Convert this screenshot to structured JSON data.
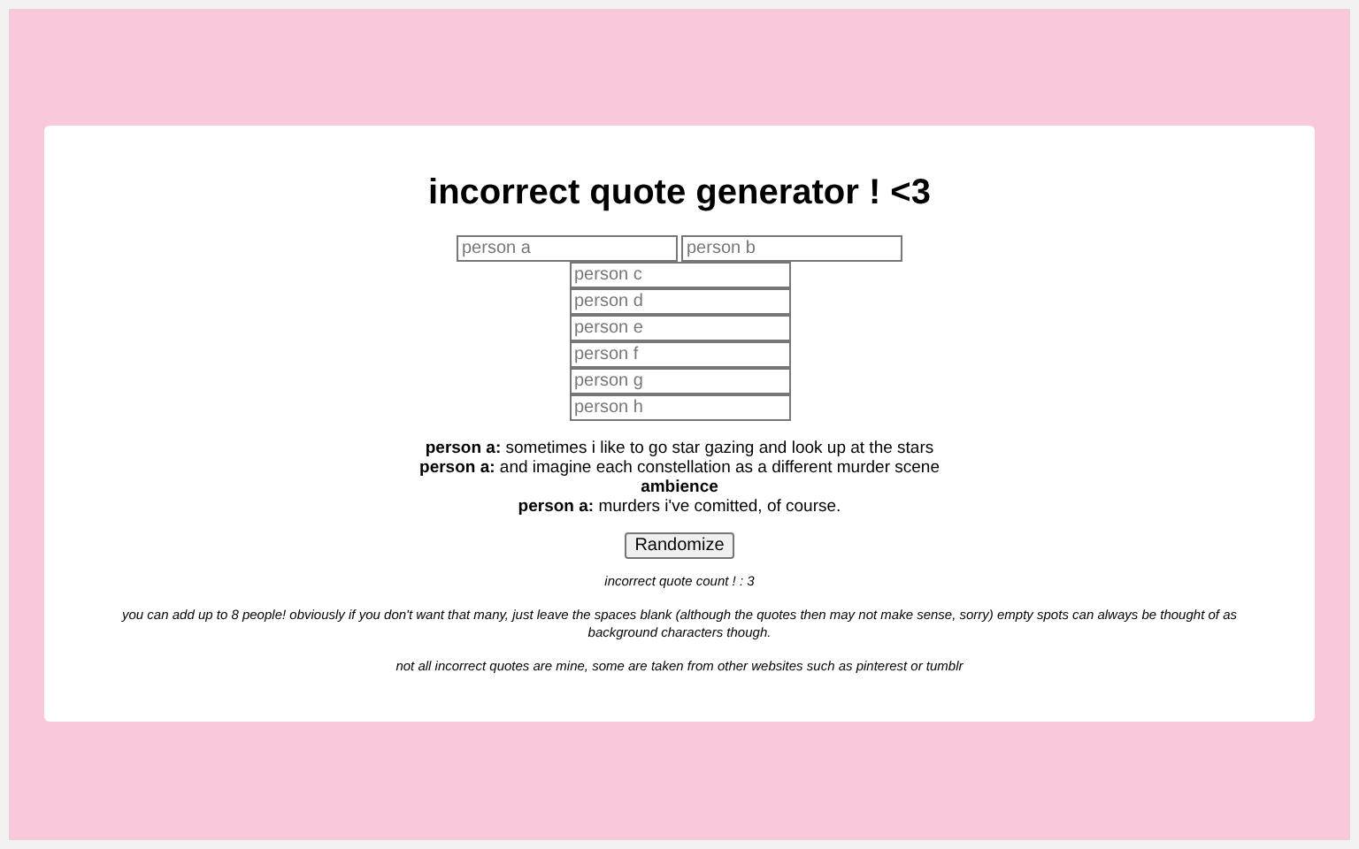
{
  "title": "incorrect quote generator ! <3",
  "inputs": [
    {
      "placeholder": "person a"
    },
    {
      "placeholder": "person b"
    },
    {
      "placeholder": "person c"
    },
    {
      "placeholder": "person d"
    },
    {
      "placeholder": "person e"
    },
    {
      "placeholder": "person f"
    },
    {
      "placeholder": "person g"
    },
    {
      "placeholder": "person h"
    }
  ],
  "quote": [
    {
      "kind": "dialogue",
      "text": "**person a:** sometimes i like to go star gazing and look up at the stars"
    },
    {
      "kind": "dialogue",
      "text": "**person a:** and imagine each constellation as a different murder scene"
    },
    {
      "kind": "action",
      "text": "ambience"
    },
    {
      "kind": "dialogue",
      "text": "**person a:** murders i've comitted, of course."
    }
  ],
  "button": "Randomize",
  "count": "incorrect quote count ! : 3",
  "notes": [
    "you can add up to 8 people! obviously if you don't want that many, just leave the spaces blank (although the quotes then may not make sense, sorry) empty spots can always be thought of as background characters though.",
    "not all incorrect quotes are mine, some are taken from other websites such as pinterest or tumblr"
  ]
}
